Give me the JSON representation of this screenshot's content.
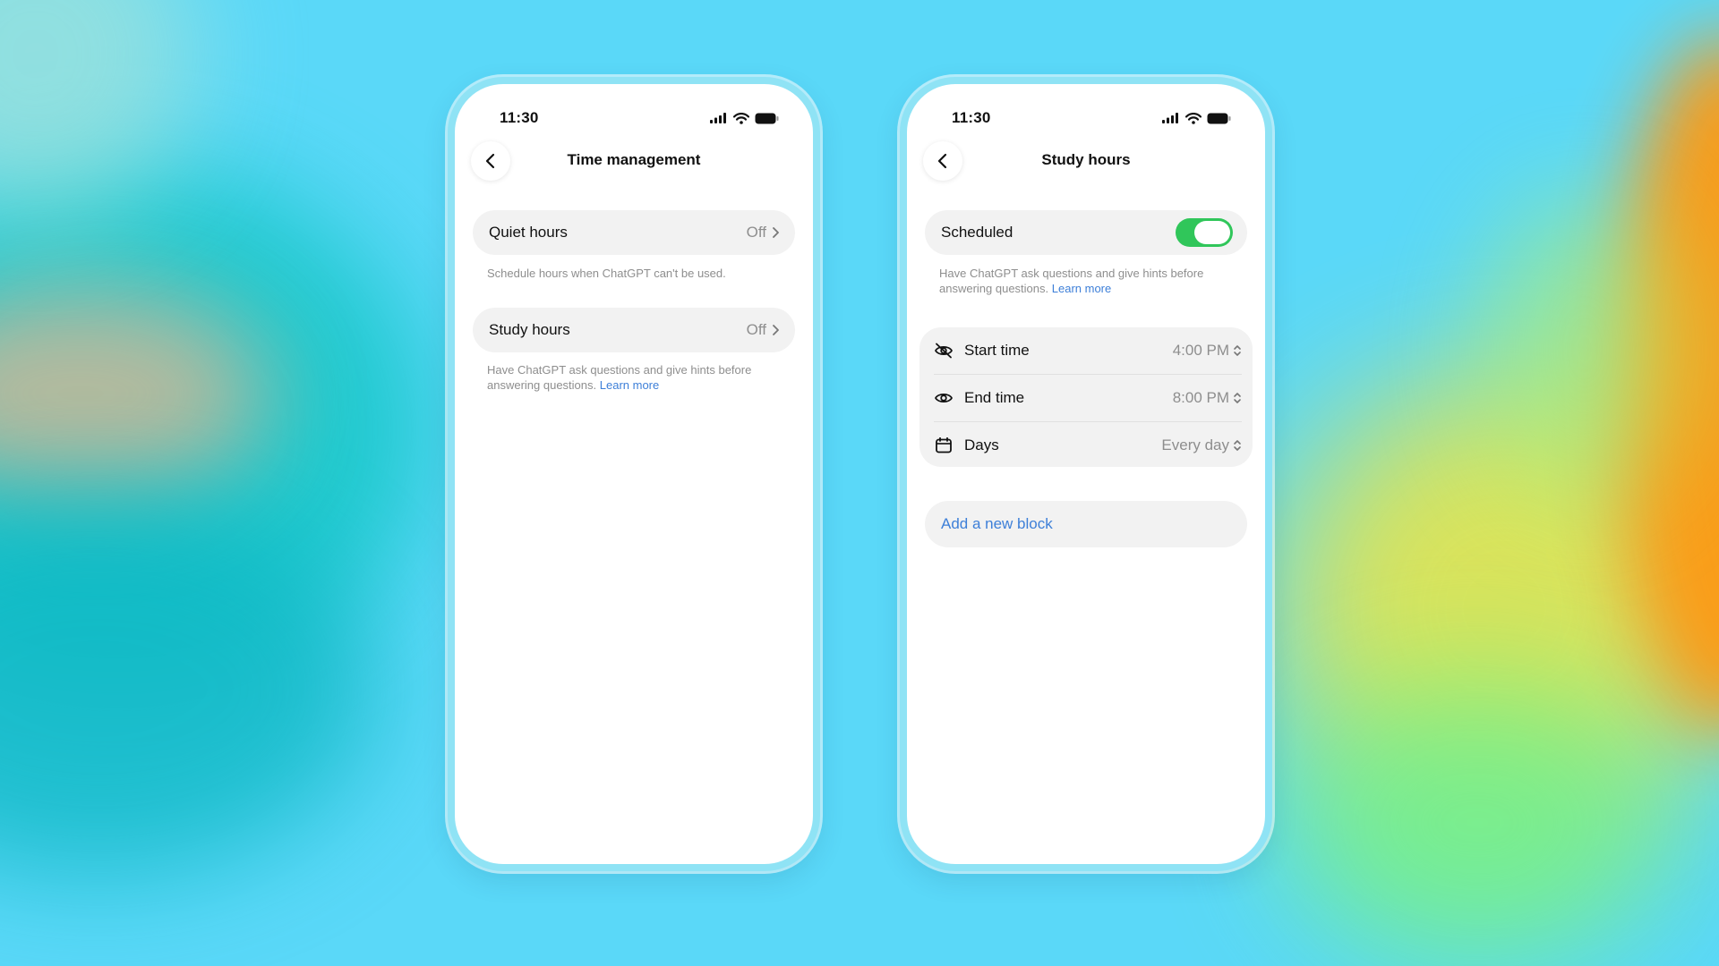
{
  "colors": {
    "accent_link": "#3d7fd8",
    "toggle_on": "#30c65a",
    "phone_frame": "#8fe3f5"
  },
  "left_phone": {
    "status_time": "11:30",
    "title": "Time management",
    "quiet_hours": {
      "label": "Quiet hours",
      "value": "Off",
      "caption": "Schedule hours when ChatGPT can't be used."
    },
    "study_hours": {
      "label": "Study hours",
      "value": "Off",
      "caption": "Have ChatGPT ask questions and give hints before answering questions.",
      "link": "Learn more"
    }
  },
  "right_phone": {
    "status_time": "11:30",
    "title": "Study hours",
    "scheduled": {
      "label": "Scheduled",
      "enabled": true,
      "caption": "Have ChatGPT ask questions and give hints before answering questions.",
      "link": "Learn more"
    },
    "settings": [
      {
        "icon": "eye-slash-icon",
        "label": "Start time",
        "value": "4:00 PM"
      },
      {
        "icon": "eye-icon",
        "label": "End time",
        "value": "8:00 PM"
      },
      {
        "icon": "calendar-icon",
        "label": "Days",
        "value": "Every day"
      }
    ],
    "add_block_label": "Add a new block"
  }
}
